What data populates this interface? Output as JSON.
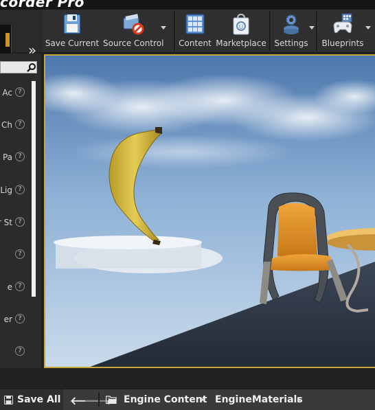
{
  "app": {
    "title_fragment": "corder Pro"
  },
  "toolbar": {
    "items": [
      {
        "label": "Save Current",
        "icon": "floppy-disk-icon",
        "dropdown": false
      },
      {
        "label": "Source Control",
        "icon": "source-control-icon",
        "dropdown": true
      },
      {
        "label": "Content",
        "icon": "content-grid-icon",
        "dropdown": false
      },
      {
        "label": "Marketplace",
        "icon": "marketplace-bag-icon",
        "dropdown": false
      },
      {
        "label": "Settings",
        "icon": "settings-gears-icon",
        "dropdown": true
      },
      {
        "label": "Blueprints",
        "icon": "blueprints-gamepad-icon",
        "dropdown": true
      }
    ]
  },
  "side_panel": {
    "search_icon": "search-icon",
    "rows": [
      {
        "text": "Ac"
      },
      {
        "text": "Ch"
      },
      {
        "text": "Pa"
      },
      {
        "text": "Lig"
      },
      {
        "text": "r St"
      },
      {
        "text": ""
      },
      {
        "text": "e"
      },
      {
        "text": "er"
      },
      {
        "text": ""
      }
    ]
  },
  "bottom": {
    "save_all_label": "Save All",
    "breadcrumbs": [
      "Engine Content",
      "EngineMaterials"
    ]
  },
  "colors": {
    "viewport_border": "#c9a63c",
    "toolbar_bg": "#2f2f2f",
    "panel_bg": "#2b2b2b"
  }
}
